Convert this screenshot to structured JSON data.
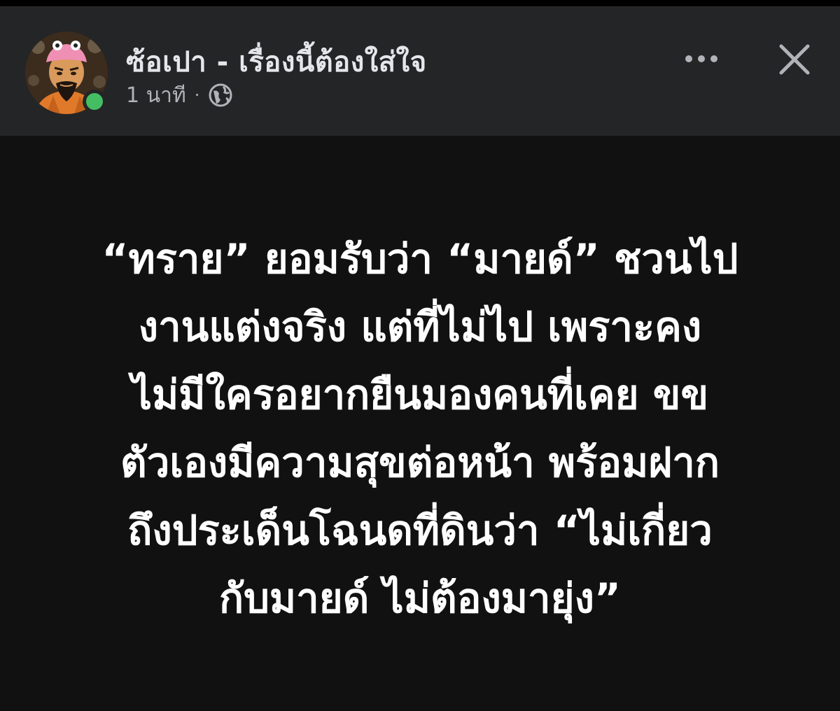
{
  "post": {
    "author": "ซ้อเปา - เรื่องนี้ต้องใส่ใจ",
    "time": "1 นาที",
    "separator": "·",
    "audience_icon": "globe-icon",
    "lines": [
      "“ทราย” ยอมรับว่า “มายด์” ชวนไป",
      "งานแต่งจริง แต่ที่ไม่ไป เพราะคง",
      "ไม่มีใครอยากยืนมองคนที่เคย ขข",
      "ตัวเองมีความสุขต่อหน้า พร้อมฝาก",
      "ถึงประเด็นโฉนดที่ดินว่า “ไม่เกี่ยว",
      "กับมายด์ ไม่ต้องมายุ่ง”"
    ]
  },
  "header": {
    "more_icon": "more-horizontal-icon",
    "close_icon": "close-icon"
  },
  "colors": {
    "header_bg": "#242526",
    "body_bg": "#111111",
    "online": "#45bd62",
    "text_primary": "#e4e6eb",
    "text_secondary": "#b0b3b8"
  }
}
